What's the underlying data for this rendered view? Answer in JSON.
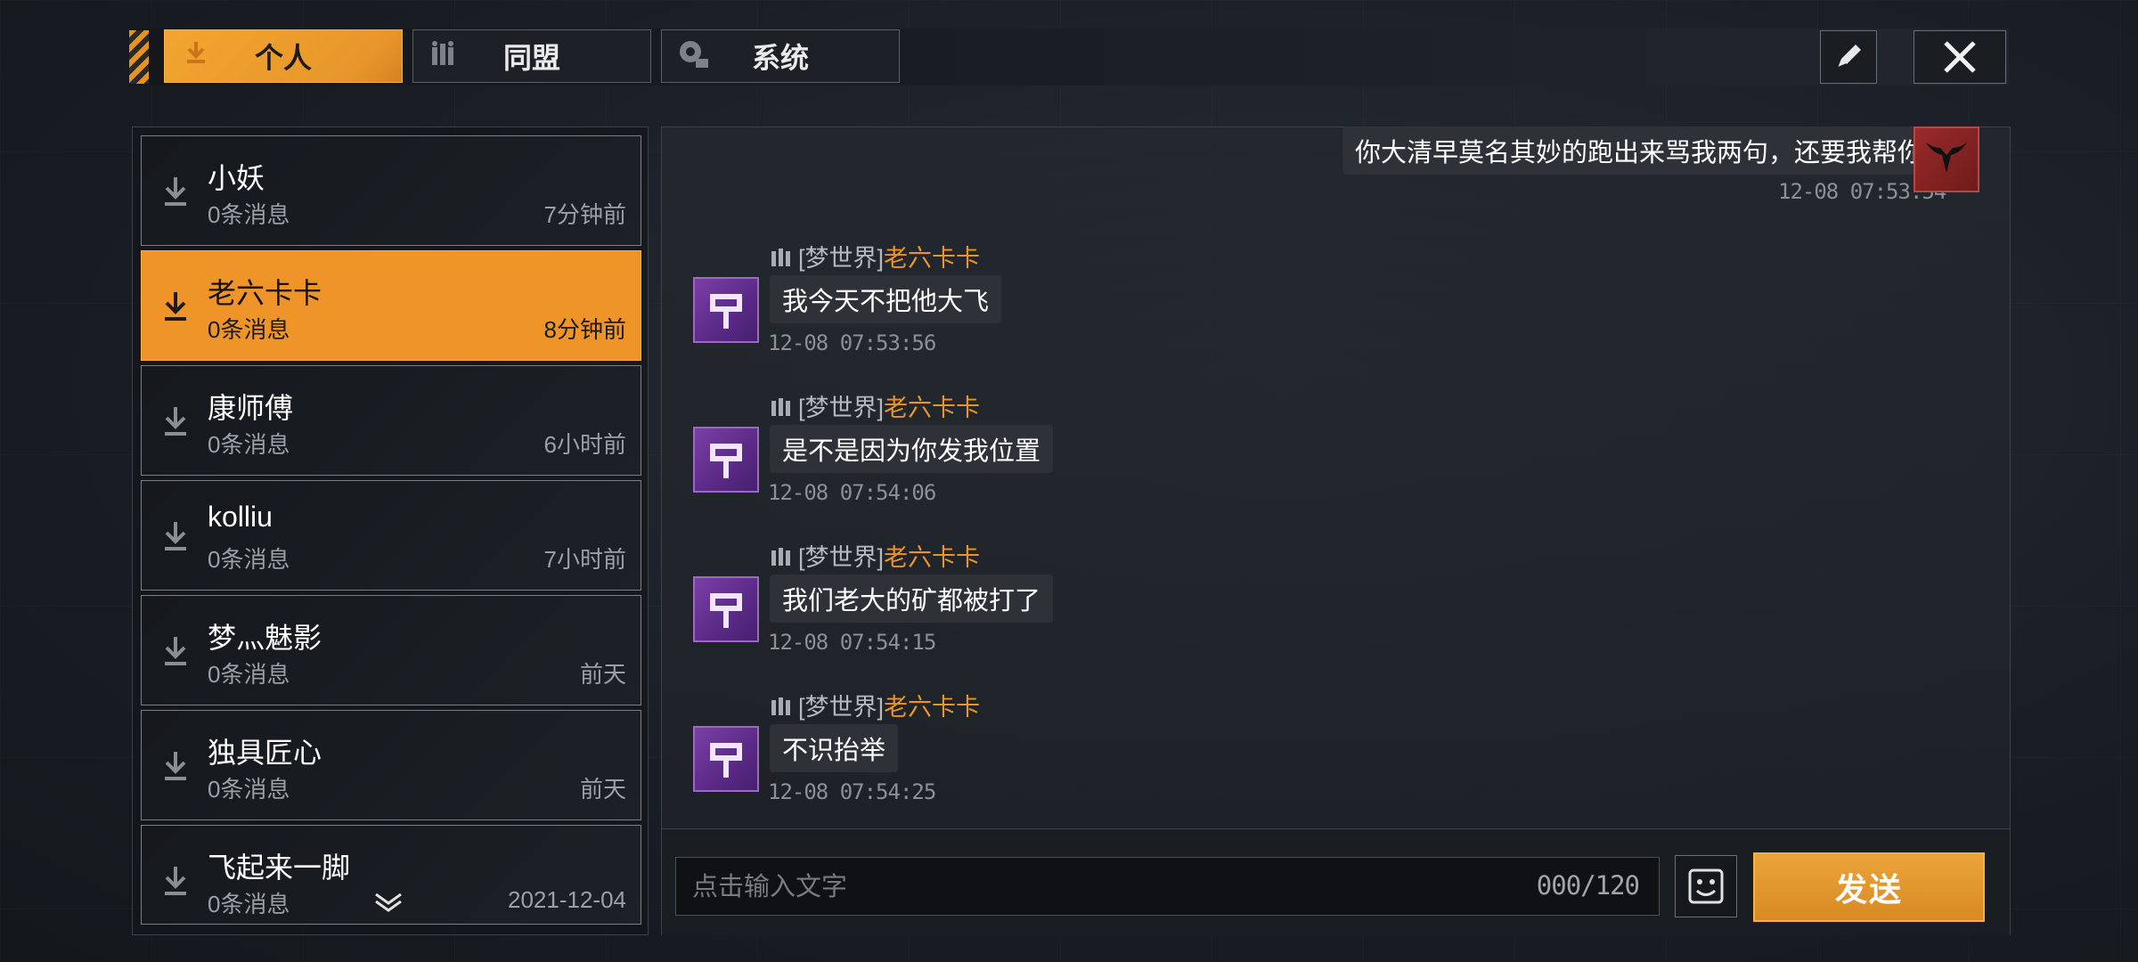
{
  "tabs": [
    {
      "label": "个人",
      "icon": "person-icon"
    },
    {
      "label": "同盟",
      "icon": "alliance-icon"
    },
    {
      "label": "系统",
      "icon": "gear-icon"
    }
  ],
  "toolbar": {
    "edit_icon": "pencil-icon",
    "close_icon": "close-icon"
  },
  "contacts": [
    {
      "name": "小妖",
      "count": "0条消息",
      "time": "7分钟前"
    },
    {
      "name": "老六卡卡",
      "count": "0条消息",
      "time": "8分钟前",
      "active": true
    },
    {
      "name": "康师傅",
      "count": "0条消息",
      "time": "6小时前"
    },
    {
      "name": "kolliu",
      "count": "0条消息",
      "time": "7小时前"
    },
    {
      "name": "梦灬魅影",
      "count": "0条消息",
      "time": "前天"
    },
    {
      "name": "独具匠心",
      "count": "0条消息",
      "time": "前天"
    },
    {
      "name": "飞起来一脚",
      "count": "0条消息",
      "time": "2021-12-04"
    }
  ],
  "chat": {
    "own_message": {
      "text": "你大清早莫名其妙的跑出来骂我两句，还要我帮你?",
      "time": "12-08 07:53:54"
    },
    "messages": [
      {
        "server": "[梦世界]",
        "nick": "老六卡卡",
        "text": "我今天不把他大飞",
        "time": "12-08 07:53:56"
      },
      {
        "server": "[梦世界]",
        "nick": "老六卡卡",
        "text": "是不是因为你发我位置",
        "time": "12-08 07:54:06"
      },
      {
        "server": "[梦世界]",
        "nick": "老六卡卡",
        "text": "我们老大的矿都被打了",
        "time": "12-08 07:54:15"
      },
      {
        "server": "[梦世界]",
        "nick": "老六卡卡",
        "text": "不识抬举",
        "time": "12-08 07:54:25"
      }
    ]
  },
  "input": {
    "placeholder": "点击输入文字",
    "counter": "000/120"
  },
  "send_label": "发送",
  "colors": {
    "accent": "#E8962A",
    "avatar_purple": "#6A2F98",
    "avatar_red": "#8E2424"
  }
}
